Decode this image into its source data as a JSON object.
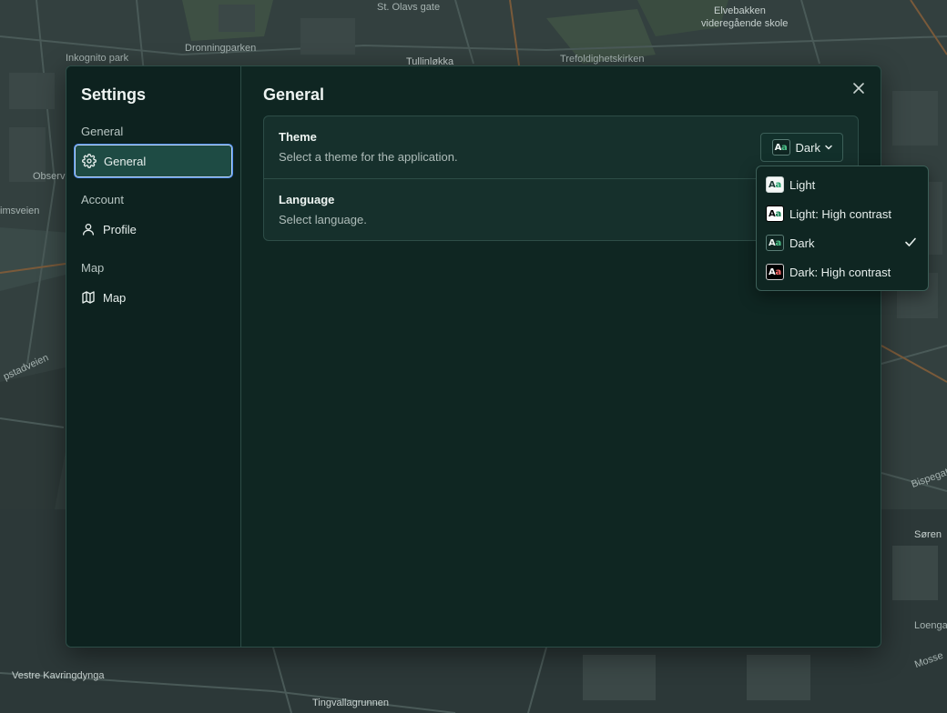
{
  "map": {
    "labels": {
      "st_olavs_gate": "St. Olavs gate",
      "elvebakken": "Elvebakken",
      "vgs": "videregående skole",
      "droningparken": "Dronningparken",
      "inkognito_park": "Inkognito park",
      "tullinlokka": "Tullinløkka",
      "trefoldighet": "Trefoldighetskirken",
      "observ": "Observ",
      "imsveien": "imsveien",
      "pstadveien": "pstadveien",
      "vestre_kavringdynga": "Vestre Kavringdynga",
      "tingvallagrunnen": "Tingvallagrunnen",
      "bjorvika": "Bispegat",
      "soren": "Søren",
      "loenga": "Loenga",
      "mosse": "Mosse"
    }
  },
  "sidebar": {
    "title": "Settings",
    "groups": [
      {
        "label": "General",
        "item": {
          "label": "General",
          "icon": "gear-icon"
        }
      },
      {
        "label": "Account",
        "item": {
          "label": "Profile",
          "icon": "user-icon"
        }
      },
      {
        "label": "Map",
        "item": {
          "label": "Map",
          "icon": "map-icon"
        }
      }
    ]
  },
  "main": {
    "title": "General",
    "theme": {
      "label": "Theme",
      "description": "Select a theme for the application.",
      "selected": "Dark",
      "badge": "Aa"
    },
    "language": {
      "label": "Language",
      "description": "Select language.",
      "icon": "uk-flag-icon"
    }
  },
  "dropdown": {
    "options": [
      {
        "label": "Light",
        "badge": "Aa",
        "selected": false
      },
      {
        "label": "Light: High contrast",
        "badge": "Aa",
        "selected": false
      },
      {
        "label": "Dark",
        "badge": "Aa",
        "selected": true
      },
      {
        "label": "Dark: High contrast",
        "badge": "Aa",
        "selected": false
      }
    ]
  },
  "colors": {
    "accent": "#4d8df0",
    "dialog_bg": "#0f2622",
    "active_item_bg": "#1e4b44",
    "badge_green": "#4cc38a"
  }
}
